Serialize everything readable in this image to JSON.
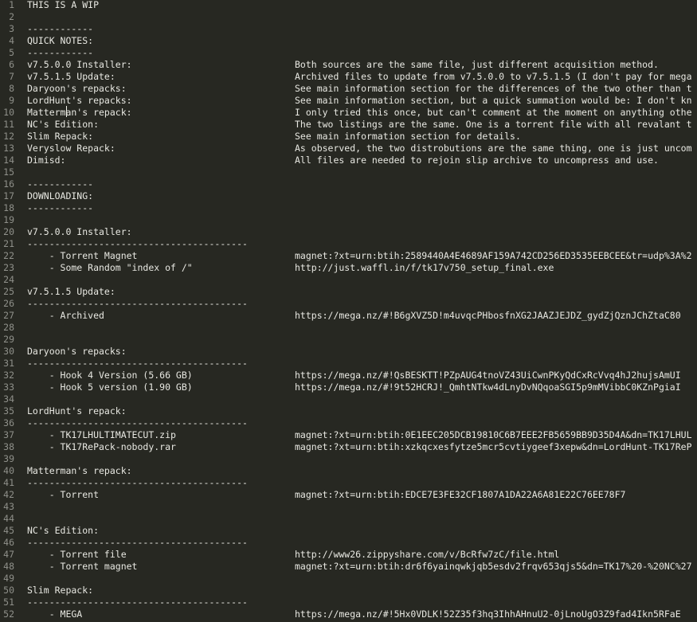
{
  "line_numbers": [
    "1",
    "2",
    "3",
    "4",
    "5",
    "6",
    "7",
    "8",
    "9",
    "10",
    "11",
    "12",
    "13",
    "14",
    "15",
    "16",
    "17",
    "18",
    "19",
    "20",
    "21",
    "22",
    "23",
    "24",
    "25",
    "26",
    "27",
    "28",
    "29",
    "30",
    "31",
    "32",
    "33",
    "34",
    "35",
    "36",
    "37",
    "38",
    "39",
    "40",
    "41",
    "42",
    "43",
    "44",
    "45",
    "46",
    "47",
    "48",
    "49",
    "50",
    "51",
    "52"
  ],
  "lines": [
    {
      "a": "THIS IS A WIP",
      "b": ""
    },
    {
      "a": "",
      "b": ""
    },
    {
      "a": "------------",
      "b": ""
    },
    {
      "a": "QUICK NOTES:",
      "b": ""
    },
    {
      "a": "------------",
      "b": ""
    },
    {
      "a": "v7.5.0.0 Installer:",
      "b": "Both sources are the same file, just different acquisition method."
    },
    {
      "a": "v7.5.1.5 Update:",
      "b": "Archived files to update from v7.5.0.0 to v7.5.1.5 (I don't pay for mega"
    },
    {
      "a": "Daryoon's repacks:",
      "b": "See main information section for the differences of the two other than t"
    },
    {
      "a": "LordHunt's repacks:",
      "b": "See main information section, but a quick summation would be: I don't kn"
    },
    {
      "a": "Matterman's repack:",
      "b": "I only tried this once, but can't comment at the moment on anything othe"
    },
    {
      "a": "NC's Edition:",
      "b": "The two listings are the same. One is a torrent file with all revalant t"
    },
    {
      "a": "Slim Repack:",
      "b": "See main information section for details."
    },
    {
      "a": "Veryslow Repack:",
      "b": "As observed, the two distrobutions are the same thing, one is just uncom"
    },
    {
      "a": "Dimisd:",
      "b": "All files are needed to rejoin slip archive to uncompress and use."
    },
    {
      "a": "",
      "b": ""
    },
    {
      "a": "------------",
      "b": ""
    },
    {
      "a": "DOWNLOADING:",
      "b": ""
    },
    {
      "a": "------------",
      "b": ""
    },
    {
      "a": "",
      "b": ""
    },
    {
      "a": "v7.5.0.0 Installer:",
      "b": ""
    },
    {
      "a": "----------------------------------------",
      "b": ""
    },
    {
      "a": "    - Torrent Magnet",
      "b": "magnet:?xt=urn:btih:2589440A4E4689AF159A742CD256ED3535EEBCEE&tr=udp%3A%2"
    },
    {
      "a": "    - Some Random \"index of /\"",
      "b": "http://just.waffl.in/f/tk17v750_setup_final.exe"
    },
    {
      "a": "",
      "b": ""
    },
    {
      "a": "v7.5.1.5 Update:",
      "b": ""
    },
    {
      "a": "----------------------------------------",
      "b": ""
    },
    {
      "a": "    - Archived",
      "b": "https://mega.nz/#!B6gXVZ5D!m4uvqcPHbosfnXG2JAAZJEJDZ_gydZjQznJChZtaC80"
    },
    {
      "a": "",
      "b": ""
    },
    {
      "a": "",
      "b": ""
    },
    {
      "a": "Daryoon's repacks:",
      "b": ""
    },
    {
      "a": "----------------------------------------",
      "b": ""
    },
    {
      "a": "    - Hook 4 Version (5.66 GB)",
      "b": "https://mega.nz/#!QsBESKTT!PZpAUG4tnoVZ43UiCwnPKyQdCxRcVvq4hJ2hujsAmUI"
    },
    {
      "a": "    - Hook 5 version (1.90 GB)",
      "b": "https://mega.nz/#!9t52HCRJ!_QmhtNTkw4dLnyDvNQqoaSGI5p9mMVibbC0KZnPgiaI"
    },
    {
      "a": "",
      "b": ""
    },
    {
      "a": "LordHunt's repack:",
      "b": ""
    },
    {
      "a": "----------------------------------------",
      "b": ""
    },
    {
      "a": "    - TK17LHULTIMATECUT.zip",
      "b": "magnet:?xt=urn:btih:0E1EEC205DCB19810C6B7EEE2FB5659BB9D35D4A&dn=TK17LHUL"
    },
    {
      "a": "    - TK17RePack-nobody.rar",
      "b": "magnet:?xt=urn:btih:xzkqcxesfytze5mcr5cvtiygeef3xepw&dn=LordHunt-TK17ReP"
    },
    {
      "a": "",
      "b": ""
    },
    {
      "a": "Matterman's repack:",
      "b": ""
    },
    {
      "a": "----------------------------------------",
      "b": ""
    },
    {
      "a": "    - Torrent",
      "b": "magnet:?xt=urn:btih:EDCE7E3FE32CF1807A1DA22A6A81E22C76EE78F7"
    },
    {
      "a": "",
      "b": ""
    },
    {
      "a": "",
      "b": ""
    },
    {
      "a": "NC's Edition:",
      "b": ""
    },
    {
      "a": "----------------------------------------",
      "b": ""
    },
    {
      "a": "    - Torrent file",
      "b": "http://www26.zippyshare.com/v/BcRfw7zC/file.html"
    },
    {
      "a": "    - Torrent magnet",
      "b": "magnet:?xt=urn:btih:dr6f6yainqwkjqb5esdv2frqv653qjs5&dn=TK17%20-%20NC%27"
    },
    {
      "a": "",
      "b": ""
    },
    {
      "a": "Slim Repack:",
      "b": ""
    },
    {
      "a": "----------------------------------------",
      "b": ""
    },
    {
      "a": "    - MEGA",
      "b": "https://mega.nz/#!5Hx0VDLK!52Z35f3hq3IhhAHnuU2-0jLnoUgO3Z9fad4Ikn5RFaE"
    }
  ]
}
